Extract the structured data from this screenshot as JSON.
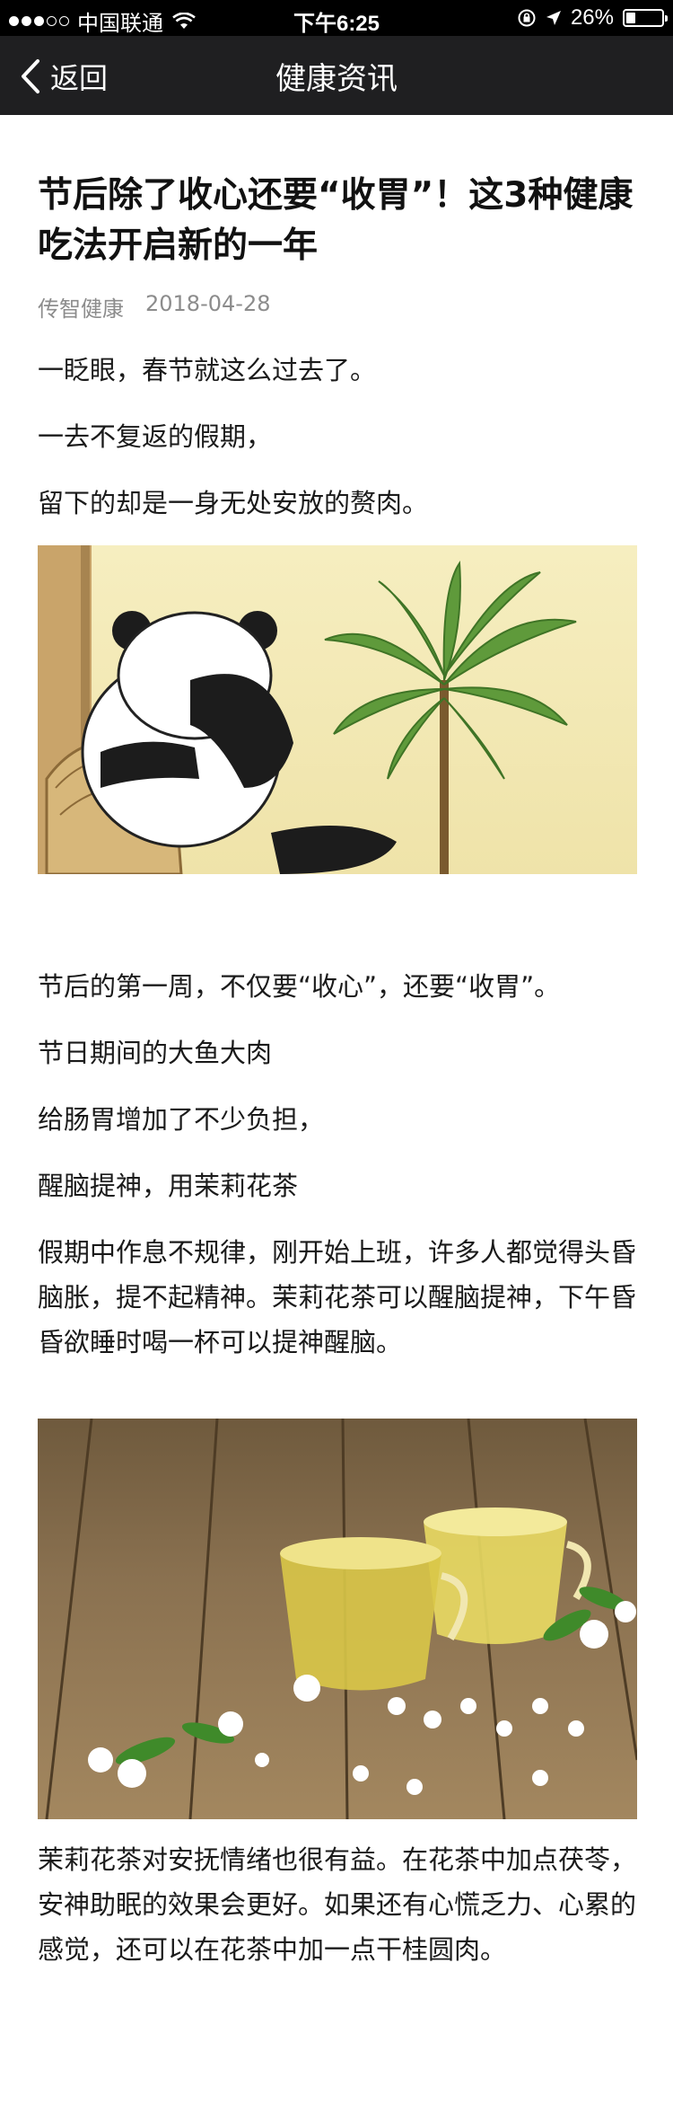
{
  "status_bar": {
    "carrier": "中国联通",
    "time": "下午6:25",
    "battery": "26%",
    "battery_level": 0.26
  },
  "nav": {
    "back_label": "返回",
    "title": "健康资讯"
  },
  "article": {
    "title": "节后除了收心还要“收胃”！这3种健康吃法开启新的一年",
    "author": "传智健康",
    "date": "2018-04-28",
    "intro": [
      "一眨眼，春节就这么过去了。",
      "一去不复返的假期，",
      "留下的却是一身无处安放的赘肉。"
    ],
    "section1": [
      "节后的第一周，不仅要“收心”，还要“收胃”。",
      "节日期间的大鱼大肉",
      "给肠胃增加了不少负担，",
      "醒脑提神，用茉莉花茶"
    ],
    "para_jasmine": "假期中作息不规律，刚开始上班，许多人都觉得头昏脑胀，提不起精神。茉莉花茶可以醒脑提神，下午昏昏欲睡时喝一杯可以提神醒脑。",
    "para_calm": "茉莉花茶对安抚情绪也很有益。在花茶中加点茯苓，安神助眠的效果会更好。如果还有心慌乏力、心累的感觉，还可以在花茶中加一点干桂圆肉。"
  }
}
